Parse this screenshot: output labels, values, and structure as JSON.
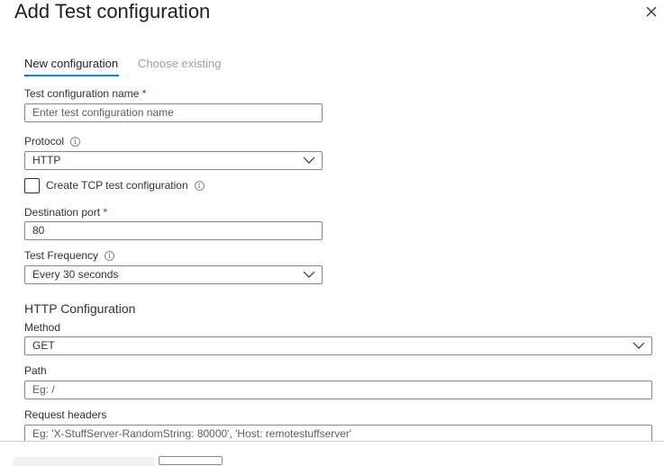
{
  "dialog": {
    "title": "Add Test configuration",
    "close_icon": "close-icon"
  },
  "tabs": [
    {
      "label": "New configuration",
      "active": true
    },
    {
      "label": "Choose existing",
      "active": false
    }
  ],
  "fields": {
    "name": {
      "label": "Test configuration name",
      "required_mark": "*",
      "placeholder": "Enter test configuration name"
    },
    "protocol": {
      "label": "Protocol",
      "info_icon": "i",
      "value": "HTTP"
    },
    "tcp_checkbox": {
      "label": "Create TCP test configuration",
      "info_icon": "i",
      "checked": false
    },
    "port": {
      "label": "Destination port",
      "required_mark": "*",
      "value": "80"
    },
    "frequency": {
      "label": "Test Frequency",
      "info_icon": "i",
      "value": "Every 30 seconds"
    }
  },
  "http": {
    "heading": "HTTP Configuration",
    "method": {
      "label": "Method",
      "value": "GET"
    },
    "path": {
      "label": "Path",
      "placeholder": "Eg: /"
    },
    "headers": {
      "label": "Request headers",
      "placeholder": "Eg: 'X-StuffServer-RandomString: 80000', 'Host: remotestuffserver'"
    }
  },
  "colors": {
    "accent": "#0078d4",
    "required": "#a4262c"
  }
}
